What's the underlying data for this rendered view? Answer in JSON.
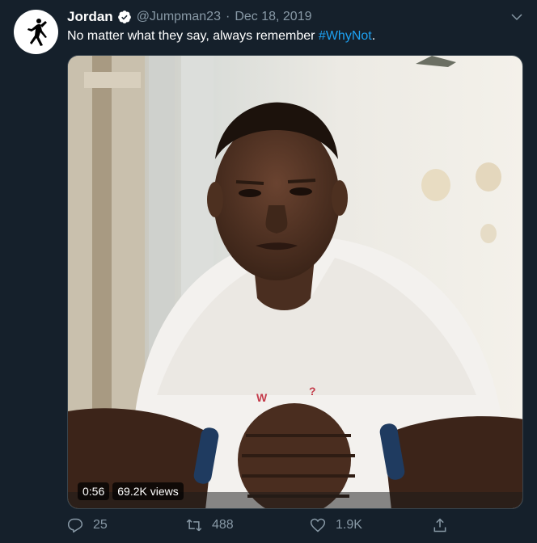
{
  "tweet": {
    "display_name": "Jordan",
    "handle": "@Jumpman23",
    "separator": "·",
    "date": "Dec 18, 2019",
    "text_prefix": "No matter what they say, always remember ",
    "hashtag": "#WhyNot",
    "text_suffix": ".",
    "verified": true
  },
  "media": {
    "duration": "0:56",
    "views": "69.2K views"
  },
  "actions": {
    "replies": "25",
    "retweets": "488",
    "likes": "1.9K"
  },
  "colors": {
    "background": "#15202b",
    "accent": "#1da1f2",
    "secondary_text": "#8899a6"
  },
  "icons": {
    "avatar": "jumpman-logo-icon",
    "verified": "verified-badge-icon",
    "menu": "chevron-down-icon",
    "reply": "reply-icon",
    "retweet": "retweet-icon",
    "like": "heart-icon",
    "share": "share-icon"
  }
}
